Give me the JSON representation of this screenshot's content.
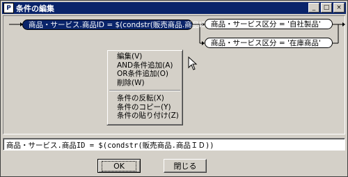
{
  "window": {
    "title": "条件の編集",
    "icon_label": "P"
  },
  "titlebar_buttons": {
    "minimize": "_",
    "maximize": "□",
    "close": "×"
  },
  "diagram": {
    "main_node": "商品・サービス.商品ID = $(condstr(販売商品.商品ID))",
    "branch_a": "商品・サービス区分 = '自社製品'",
    "branch_b": "商品・サービス区分 = '在庫商品'"
  },
  "context_menu": {
    "items_group1": [
      "編集(V)",
      "AND条件追加(A)",
      "OR条件追加(O)",
      "削除(W)"
    ],
    "items_group2": [
      "条件の反転(X)",
      "条件のコピー(Y)",
      "条件の貼り付け(Z)"
    ]
  },
  "expression": {
    "value": "商品・サービス.商品ID = $(condstr(販売商品.商品ＩＤ))"
  },
  "buttons": {
    "ok": "OK",
    "close": "閉じる"
  }
}
